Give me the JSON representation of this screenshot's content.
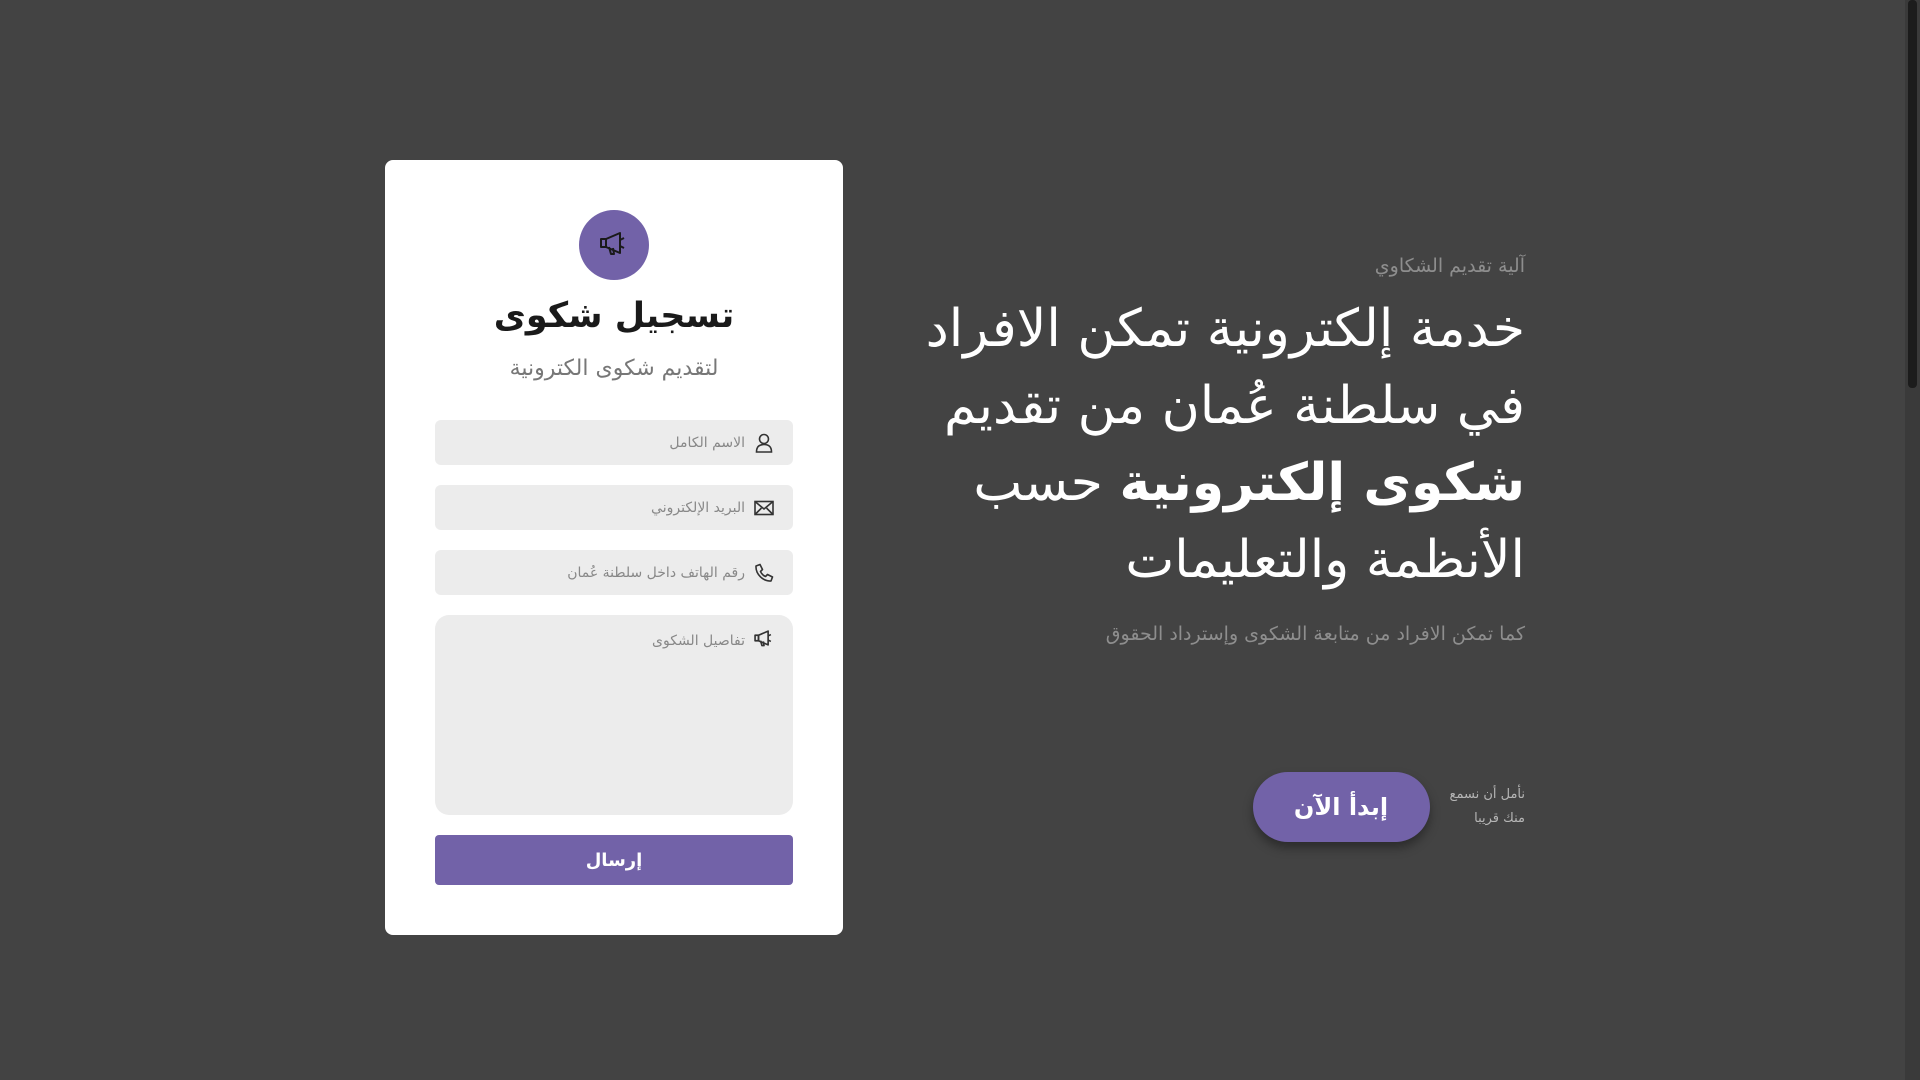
{
  "colors": {
    "background": "#434343",
    "accent": "#7262a8",
    "card": "#ffffff",
    "field": "#ececec"
  },
  "form": {
    "icon": "megaphone-icon",
    "title": "تسجيل شكوى",
    "subtitle": "لتقديم شكوى الكترونية",
    "fields": [
      {
        "icon": "user-icon",
        "placeholder": "الاسم الكامل",
        "value": ""
      },
      {
        "icon": "envelope-icon",
        "placeholder": "البريد الإلكتروني",
        "value": ""
      },
      {
        "icon": "phone-icon",
        "placeholder": "رقم الهاتف داخل سلطنة عُمان",
        "value": ""
      },
      {
        "icon": "megaphone-icon",
        "placeholder": "تفاصيل الشكوى",
        "value": ""
      }
    ],
    "submit_label": "إرسال"
  },
  "hero": {
    "eyebrow": "آلية تقديم الشكاوي",
    "headline": {
      "part1": "خدمة إلكترونية تمكن الافراد في سلطنة عُمان من تقديم ",
      "bold": "شكوى إلكترونية",
      "part2": " حسب الأنظمة والتعليمات"
    },
    "lead": "كما تمكن الافراد من متابعة الشكوى وإسترداد الحقوق",
    "cta_label": "إبدأ الآن",
    "cta_note_line1": "نأمل أن نسمع",
    "cta_note_line2": "منك قريبا"
  }
}
